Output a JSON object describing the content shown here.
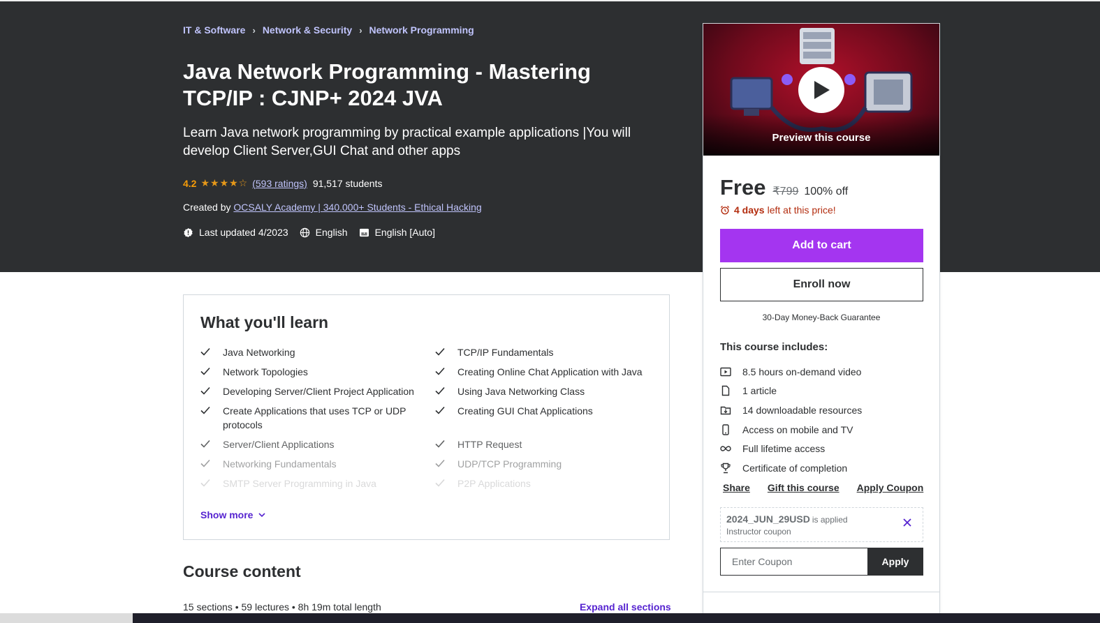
{
  "breadcrumb": [
    "IT & Software",
    "Network & Security",
    "Network Programming"
  ],
  "course": {
    "title": "Java Network Programming - Mastering TCP/IP : CJNP+ 2024 JVA",
    "subtitle": "Learn Java network programming by practical example applications |You will develop Client Server,GUI Chat and other apps",
    "rating": "4.2",
    "stars_filled": 4,
    "ratings_link": "(593 ratings)",
    "students": "91,517 students",
    "created_by_label": "Created by",
    "instructor": "OCSALY Academy | 340.000+ Students - Ethical Hacking",
    "last_updated": "Last updated 4/2023",
    "language": "English",
    "captions": "English [Auto]"
  },
  "learn": {
    "heading": "What you'll learn",
    "left": [
      "Java Networking",
      "Network Topologies",
      "Developing Server/Client Project Application",
      "Create Applications that uses TCP or UDP protocols",
      "Server/Client Applications",
      "Networking Fundamentals",
      "SMTP Server Programming in Java"
    ],
    "right": [
      "TCP/IP Fundamentals",
      "Creating Online Chat Application with Java",
      "Using Java Networking Class",
      "Creating GUI Chat Applications",
      "HTTP Request",
      "UDP/TCP Programming",
      "P2P Applications"
    ],
    "show_more": "Show more"
  },
  "course_content": {
    "heading": "Course content",
    "meta": "15 sections • 59 lectures • 8h 19m total length",
    "expand_all": "Expand all sections"
  },
  "sidebar": {
    "preview_label": "Preview this course",
    "price": "Free",
    "original_price": "₹799",
    "discount": "100% off",
    "timer_bold": "4 days",
    "timer_rest": "left at this price!",
    "add_to_cart": "Add to cart",
    "enroll_now": "Enroll now",
    "guarantee": "30-Day Money-Back Guarantee",
    "includes_title": "This course includes:",
    "includes": [
      {
        "icon": "video-icon",
        "label": "8.5 hours on-demand video"
      },
      {
        "icon": "file-icon",
        "label": "1 article"
      },
      {
        "icon": "download-icon",
        "label": "14 downloadable resources"
      },
      {
        "icon": "mobile-icon",
        "label": "Access on mobile and TV"
      },
      {
        "icon": "infinity-icon",
        "label": "Full lifetime access"
      },
      {
        "icon": "trophy-icon",
        "label": "Certificate of completion"
      }
    ],
    "share": "Share",
    "gift": "Gift this course",
    "apply_coupon": "Apply Coupon",
    "coupon_code": "2024_JUN_29USD",
    "coupon_applied": "is applied",
    "coupon_type": "Instructor coupon",
    "coupon_placeholder": "Enter Coupon",
    "coupon_apply_button": "Apply"
  },
  "colors": {
    "hero_bg": "#2d2f31",
    "link_light": "#c0c4fc",
    "rating": "#f69c08",
    "cart": "#a435f0",
    "link_purple": "#5624d0",
    "timer_red": "#b32d0f"
  }
}
